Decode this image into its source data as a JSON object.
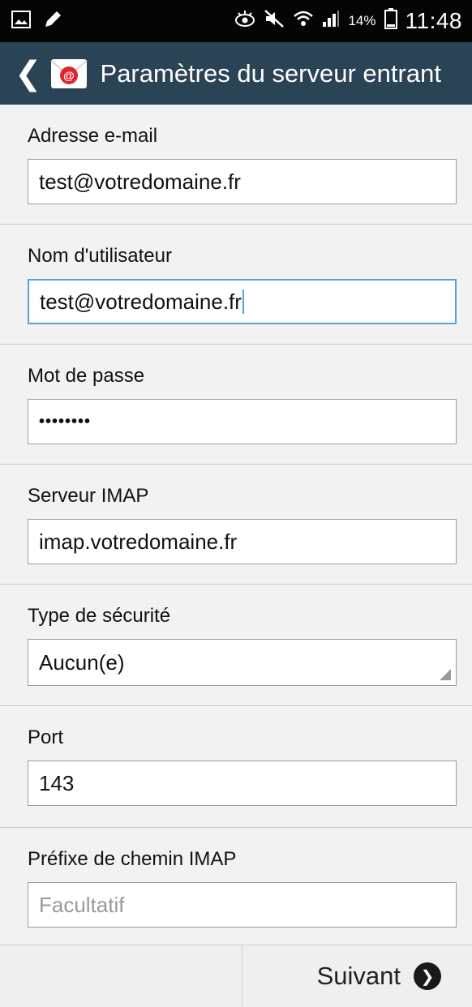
{
  "status_bar": {
    "battery_percent": "14%",
    "time": "11:48",
    "icons": [
      "image-icon",
      "edit-icon",
      "eye-icon",
      "mute-icon",
      "wifi-icon",
      "signal-icon",
      "battery-icon"
    ]
  },
  "action_bar": {
    "back_icon": "chevron-left-icon",
    "app_icon": "email-app-icon",
    "title": "Paramètres du serveur entrant"
  },
  "form": {
    "email": {
      "label": "Adresse e-mail",
      "value": "test@votredomaine.fr"
    },
    "username": {
      "label": "Nom d'utilisateur",
      "value": "test@votredomaine.fr"
    },
    "password": {
      "label": "Mot de passe",
      "value": "••••••••"
    },
    "imap_server": {
      "label": "Serveur IMAP",
      "value": "imap.votredomaine.fr"
    },
    "security_type": {
      "label": "Type de sécurité",
      "value": "Aucun(e)"
    },
    "port": {
      "label": "Port",
      "value": "143"
    },
    "imap_prefix": {
      "label": "Préfixe de chemin IMAP",
      "placeholder": "Facultatif"
    }
  },
  "bottom_bar": {
    "next_label": "Suivant",
    "next_icon": "arrow-right-circle-icon"
  },
  "colors": {
    "action_bar": "#2a4355",
    "status_bar": "#050505",
    "focus_border": "#4fa3de",
    "background": "#f2f2f2"
  }
}
